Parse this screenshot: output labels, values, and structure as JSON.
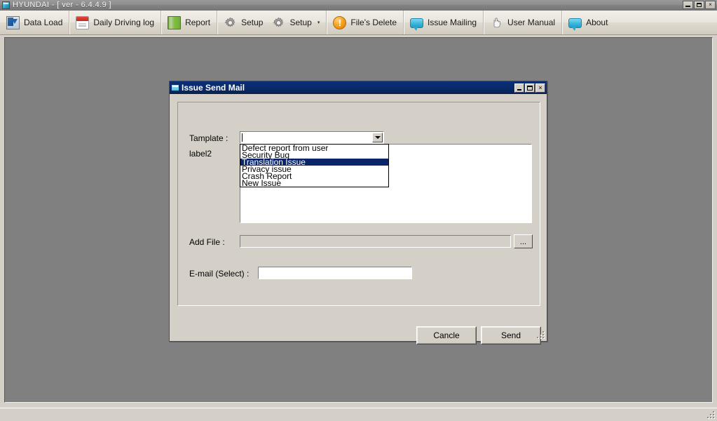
{
  "window": {
    "title": "HYUNDAI -  [ ver - 6.4.4.9 ]",
    "icon": "app-icon",
    "controls": {
      "minimize": "_",
      "maximize": "[]",
      "close": "×"
    }
  },
  "toolbar": {
    "items": [
      {
        "label": "Data Load",
        "icon": "monitor-download-icon",
        "has_caret": false
      },
      {
        "label": "Daily Driving log",
        "icon": "calendar-icon",
        "has_caret": false
      },
      {
        "label": "Report",
        "icon": "notebook-icon",
        "has_caret": false
      },
      {
        "label": "Setup",
        "icon": "gear-icon",
        "has_caret": false
      },
      {
        "label": "Setup",
        "icon": "gear-icon",
        "has_caret": true,
        "caret": "▾"
      },
      {
        "label": "File's Delete",
        "icon": "warning-icon",
        "has_caret": false,
        "glyph": "!"
      },
      {
        "label": "Issue Mailing",
        "icon": "speech-bubble-icon",
        "has_caret": false
      },
      {
        "label": "User Manual",
        "icon": "hand-pointer-icon",
        "has_caret": false
      },
      {
        "label": "About",
        "icon": "speech-bubble-icon",
        "has_caret": false
      }
    ]
  },
  "dialog": {
    "title": "Issue Send Mail",
    "icon": "window-icon",
    "controls": {
      "minimize": "_",
      "maximize": "[]",
      "close": "×"
    },
    "fields": {
      "template_label": "Tamplate :",
      "template_value": "",
      "label2": "label2",
      "body_text": "",
      "addfile_label": "Add File :",
      "addfile_value": "",
      "browse_label": "...",
      "email_label": "E-mail (Select) :",
      "email_value": ""
    },
    "dropdown": {
      "open": true,
      "selected_index": 2,
      "items": [
        "Defect report from user",
        "Security Bug",
        "Translation Issue",
        "Privacy issue",
        "Crash Report",
        "New Issue"
      ]
    },
    "buttons": {
      "cancel": "Cancle",
      "send": "Send"
    }
  },
  "colors": {
    "face": "#d4d0c8",
    "mdi_background": "#808080",
    "dialog_titlebar": "#0a2a6c",
    "selection": "#0a246a",
    "app_titlebar": "#8e8e8e"
  }
}
